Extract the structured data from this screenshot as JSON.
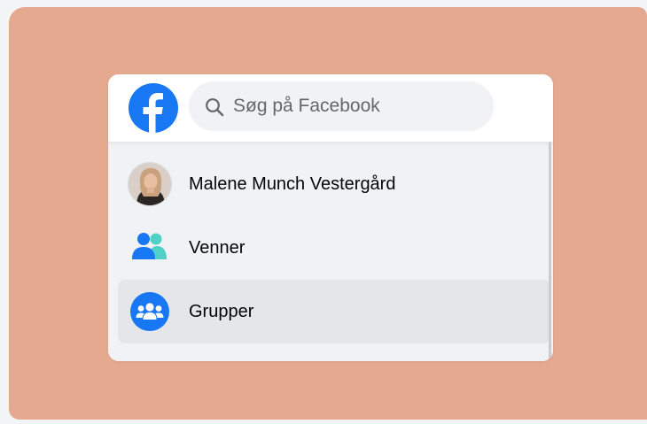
{
  "search": {
    "placeholder": "Søg på Facebook"
  },
  "menu": {
    "items": [
      {
        "label": "Malene Munch Vestergård",
        "icon": "profile-avatar",
        "active": false
      },
      {
        "label": "Venner",
        "icon": "friends-icon",
        "active": false
      },
      {
        "label": "Grupper",
        "icon": "groups-icon",
        "active": true
      }
    ]
  },
  "colors": {
    "backdrop": "#e5a98f",
    "brand": "#1877f2",
    "menu_bg": "#f0f2f5",
    "active_bg": "#e4e6e9"
  }
}
